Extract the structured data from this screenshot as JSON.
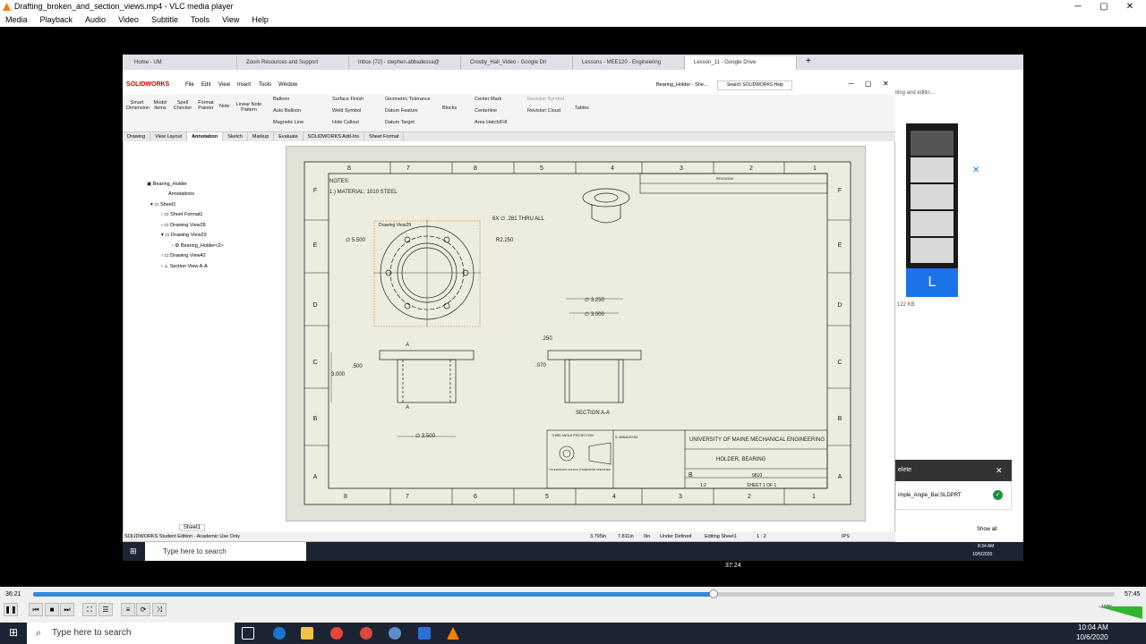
{
  "vlc": {
    "title": "Drafting_broken_and_section_views.mp4 - VLC media player",
    "menu": [
      "Media",
      "Playback",
      "Audio",
      "Video",
      "Subtitle",
      "Tools",
      "View",
      "Help"
    ],
    "time_elapsed": "36:21",
    "time_total": "57:45",
    "hover_time": "37:24",
    "progress": 0.6295,
    "volume": "100%"
  },
  "taskbar": {
    "search": "Type here to search",
    "time": "10:04 AM",
    "date": "10/6/2020"
  },
  "chrome": {
    "tabs": [
      "Home - UM",
      "Zoom Resources and Support",
      "Inbox (72) - stephen.abbadessa@",
      "Crosby_Hall_Video - Google Dri",
      "Lessons - MEE120 - Engineering",
      "Lesson_11 - Google Drive"
    ]
  },
  "sw": {
    "logo": "SOLIDWORKS",
    "menu": [
      "File",
      "Edit",
      "View",
      "Insert",
      "Tools",
      "Window"
    ],
    "doc": "Bearing_Holder - She...",
    "search": "Search SOLIDWORKS Help",
    "ribbon": {
      "smart": "Smart Dimension",
      "model": "Model Items",
      "spell": "Spell Checker",
      "format": "Format Painter",
      "note": "Note",
      "linear": "Linear Note Pattern",
      "balloon": "Balloon",
      "autoballoon": "Auto Balloon",
      "magnetic": "Magnetic Line",
      "surface": "Surface Finish",
      "weld": "Weld Symbol",
      "hole": "Hole Callout",
      "geo": "Geometric Tolerance",
      "datumf": "Datum Feature",
      "datumt": "Datum Target",
      "blocks": "Blocks",
      "center": "Center Mark",
      "centerline": "Centerline",
      "hatch": "Area Hatch/Fill",
      "revsym": "Revision Symbol",
      "revcloud": "Revision Cloud",
      "tables": "Tables"
    },
    "tabs": [
      "Drawing",
      "View Layout",
      "Annotation",
      "Sketch",
      "Markup",
      "Evaluate",
      "SOLIDWORKS Add-Ins",
      "Sheet Format"
    ],
    "tree": [
      "Bearing_Holder",
      "Annotations",
      "Sheet1",
      "Sheet Format1",
      "Drawing View28",
      "Drawing View29",
      "Bearing_Holder<2>",
      "Drawing View42",
      "Section View A-A"
    ],
    "sheet_tab": "Sheet1",
    "status": {
      "edition": "SOLIDWORKS Student Edition - Academic Use Only",
      "x": "3.795in",
      "y": "7.811in",
      "z": "0in",
      "def": "Under Defined",
      "editing": "Editing Sheet1",
      "scale": "1 : 2",
      "units": "IPS"
    }
  },
  "drawing": {
    "cols_top": [
      "8",
      "7",
      "8",
      "5",
      "4",
      "3",
      "2",
      "1"
    ],
    "cols_bot": [
      "8",
      "7",
      "6",
      "5",
      "4",
      "3",
      "2",
      "1"
    ],
    "rows": [
      "F",
      "E",
      "D",
      "C",
      "B",
      "A"
    ],
    "notes": "NOTES:",
    "note1": "1.) MATERIAL: 1010 STEEL",
    "viewlabel": "Drawing View29",
    "holes": "6X ∅ .281 THRU ALL",
    "bc": "∅ 5.500",
    "r": "R2.250",
    "d1": "∅ 3.250",
    "d2": "∅ 3.000",
    "t250": ".250",
    "t070": ".070",
    "h3": "3.000",
    "h500": ".500",
    "d35": "∅ 3.500",
    "section": "SECTION A-A",
    "A": "A",
    "tb": {
      "org": "UNIVERSITY OF MAINE MECHANICAL ENGINEERING",
      "title": "HOLDER, BEARING",
      "size": "B",
      "num": "9810",
      "scale": "1:2",
      "sheet": "SHEET 1 OF 1",
      "proj": "THIRD ANGLE PROJECTION",
      "drawn": "S. ABBADESSA",
      "revisions": "REVISIONS",
      "tol": "TOLERANCES UNLESS OTHERWISE SPECIFIED"
    }
  },
  "zoom": {
    "avatar": "L",
    "file": "imple_Angle_Bar.SLDPRT",
    "notif": "elete",
    "showall": "Show all",
    "kb": "122 KB",
    "editing": "iting and editin..."
  },
  "inner_taskbar": {
    "search": "Type here to search",
    "time": "8:34 AM",
    "date": "10/6/2020"
  }
}
